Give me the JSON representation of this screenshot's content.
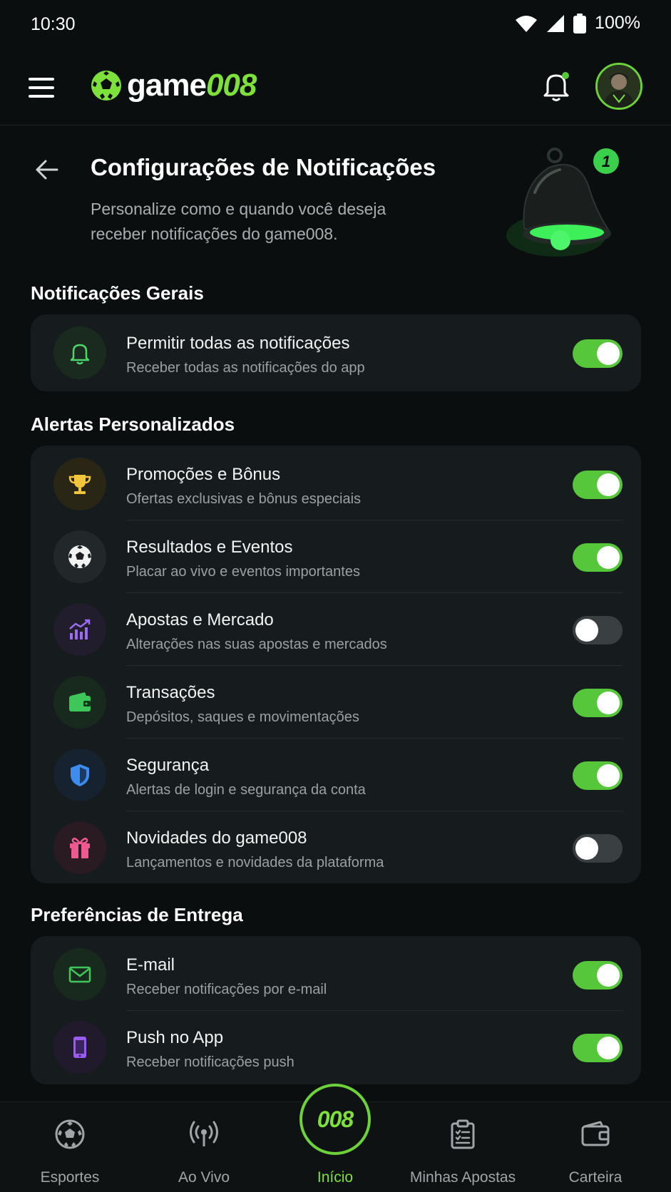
{
  "status_bar": {
    "time": "10:30",
    "battery": "100%"
  },
  "app": {
    "logo_part1": "game",
    "logo_part2": "008"
  },
  "header": {
    "title": "Configurações de Notificações",
    "subtitle": "Personalize como e quando você deseja receber notificações do game008.",
    "badge_count": "1"
  },
  "sections": {
    "general": {
      "title": "Notificações Gerais",
      "items": [
        {
          "label": "Permitir todas as notificações",
          "description": "Receber todas as notificações do app",
          "enabled": true,
          "icon": "bell-icon"
        }
      ]
    },
    "custom": {
      "title": "Alertas Personalizados",
      "items": [
        {
          "label": "Promoções e Bônus",
          "description": "Ofertas exclusivas e bônus especiais",
          "enabled": true,
          "icon": "trophy-icon"
        },
        {
          "label": "Resultados e Eventos",
          "description": "Placar ao vivo e eventos importantes",
          "enabled": true,
          "icon": "soccer-ball-icon"
        },
        {
          "label": "Apostas e Mercado",
          "description": "Alterações nas suas apostas e mercados",
          "enabled": false,
          "icon": "chart-icon"
        },
        {
          "label": "Transações",
          "description": "Depósitos, saques e movimentações",
          "enabled": true,
          "icon": "wallet-icon"
        },
        {
          "label": "Segurança",
          "description": "Alertas de login e segurança da conta",
          "enabled": true,
          "icon": "shield-icon"
        },
        {
          "label": "Novidades do game008",
          "description": "Lançamentos e novidades da plataforma",
          "enabled": false,
          "icon": "gift-icon"
        }
      ]
    },
    "delivery": {
      "title": "Preferências de Entrega",
      "items": [
        {
          "label": "E-mail",
          "description": "Receber notificações por e-mail",
          "enabled": true,
          "icon": "mail-icon"
        },
        {
          "label": "Push no App",
          "description": "Receber notificações push",
          "enabled": true,
          "icon": "phone-icon"
        }
      ]
    }
  },
  "bottom_nav": {
    "items": [
      {
        "label": "Esportes",
        "icon": "soccer-ball-icon"
      },
      {
        "label": "Ao Vivo",
        "icon": "broadcast-icon"
      },
      {
        "label": "Início",
        "icon": "home-logo-icon",
        "active": true,
        "badge_text": "008"
      },
      {
        "label": "Minhas Apostas",
        "icon": "clipboard-icon"
      },
      {
        "label": "Carteira",
        "icon": "wallet-icon"
      }
    ]
  },
  "colors": {
    "background": "#0b0e0f",
    "card": "#161b1d",
    "accent": "#7ee03a",
    "toggle_on": "#56c63a",
    "toggle_off": "#3a3f41",
    "muted_text": "#9aa1a3"
  }
}
